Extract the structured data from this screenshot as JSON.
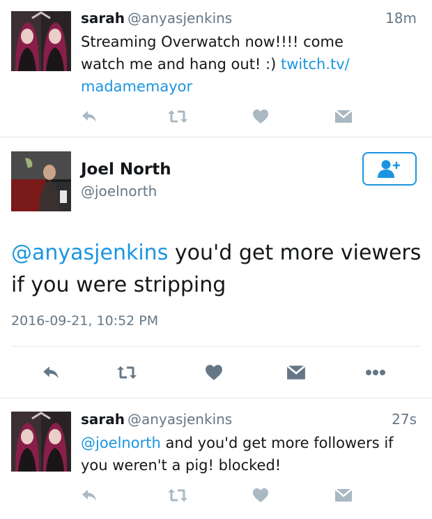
{
  "tweet1": {
    "name": "sarah",
    "handle": "@anyasjenkins",
    "time": "18m",
    "text_before_link": "Streaming Overwatch now!!!! come watch me and hang out! :) ",
    "link": "twitch.tv/ madamemayor"
  },
  "main_tweet": {
    "name": "Joel North",
    "handle": "@joelnorth",
    "mention": "@anyasjenkins",
    "text": " you'd get more viewers if you were stripping",
    "timestamp": "2016-09-21, 10:52 PM"
  },
  "tweet3": {
    "name": "sarah",
    "handle": "@anyasjenkins",
    "time": "27s",
    "mention": "@joelnorth",
    "text": " and you'd get more followers if you weren't a pig! blocked!"
  },
  "icons": {
    "reply": "reply-icon",
    "retweet": "retweet-icon",
    "like": "heart-icon",
    "dm": "envelope-icon",
    "more": "more-icon",
    "follow": "follow-user-icon"
  },
  "colors": {
    "link": "#1b95e0",
    "secondary_text": "#657786",
    "icon_muted": "#aab8c2",
    "icon_dark": "#657786",
    "divider": "#e1e8ed"
  }
}
